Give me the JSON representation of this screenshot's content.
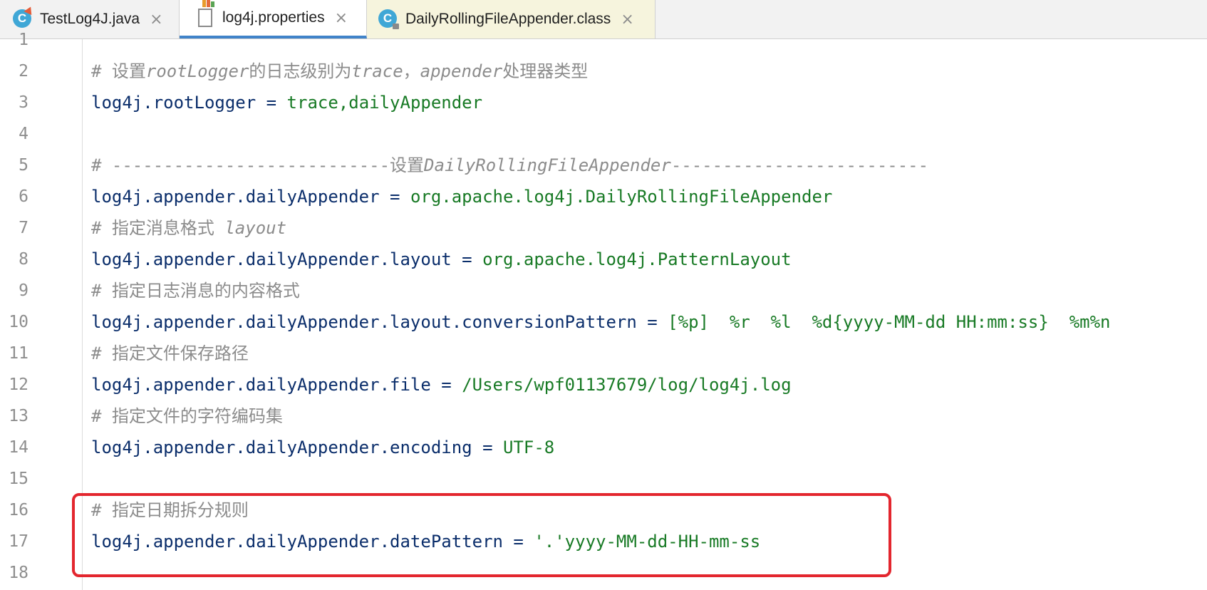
{
  "tabs": [
    {
      "label": "TestLog4J.java",
      "icon": "java-class-icon",
      "close": "×"
    },
    {
      "label": "log4j.properties",
      "icon": "properties-file-icon",
      "close": "×"
    },
    {
      "label": "DailyRollingFileAppender.class",
      "icon": "class-file-icon",
      "close": "×"
    }
  ],
  "class_icon_letter": "C",
  "line_numbers": [
    "1",
    "2",
    "3",
    "4",
    "5",
    "6",
    "7",
    "8",
    "9",
    "10",
    "11",
    "12",
    "13",
    "14",
    "15",
    "16",
    "17",
    "18"
  ],
  "lines": {
    "l2": {
      "hash": "# ",
      "t1": "设置",
      "t2": "rootLogger",
      "t3": "的日志级别为",
      "t4": "trace",
      "t5": "，",
      "t6": "appender",
      "t7": "处理器类型"
    },
    "l3": {
      "key": "log4j.rootLogger",
      "eq": " = ",
      "value": "trace,dailyAppender"
    },
    "l5": {
      "hash": "# ",
      "t1": "---------------------------设置",
      "t2": "DailyRollingFileAppender",
      "t3": "-------------------------"
    },
    "l6": {
      "key": "log4j.appender.dailyAppender",
      "eq": " = ",
      "value": "org.apache.log4j.DailyRollingFileAppender"
    },
    "l7": {
      "hash": "# ",
      "t1": "指定消息格式 ",
      "t2": "layout"
    },
    "l8": {
      "key": "log4j.appender.dailyAppender.layout",
      "eq": " = ",
      "value": "org.apache.log4j.PatternLayout"
    },
    "l9": {
      "text": "# 指定日志消息的内容格式"
    },
    "l10": {
      "key": "log4j.appender.dailyAppender.layout.conversionPattern",
      "eq": " = ",
      "value": "[%p]  %r  %l  %d{yyyy-MM-dd HH:mm:ss}  %m%n"
    },
    "l11": {
      "text": "# 指定文件保存路径"
    },
    "l12": {
      "key": "log4j.appender.dailyAppender.file",
      "eq": " = ",
      "value": "/Users/wpf01137679/log/log4j.log"
    },
    "l13": {
      "text": "# 指定文件的字符编码集"
    },
    "l14": {
      "key": "log4j.appender.dailyAppender.encoding",
      "eq": " = ",
      "value": "UTF-8"
    },
    "l16": {
      "text": "# 指定日期拆分规则"
    },
    "l17": {
      "key": "log4j.appender.dailyAppender.datePattern",
      "eq": " = ",
      "value": "'.'yyyy-MM-dd-HH-mm-ss"
    }
  },
  "colors": {
    "highlight": "#e3262e",
    "comment": "#8c8c8c",
    "key": "#0b2e6b",
    "value": "#187a25",
    "active_tab_underline": "#4083c9"
  }
}
